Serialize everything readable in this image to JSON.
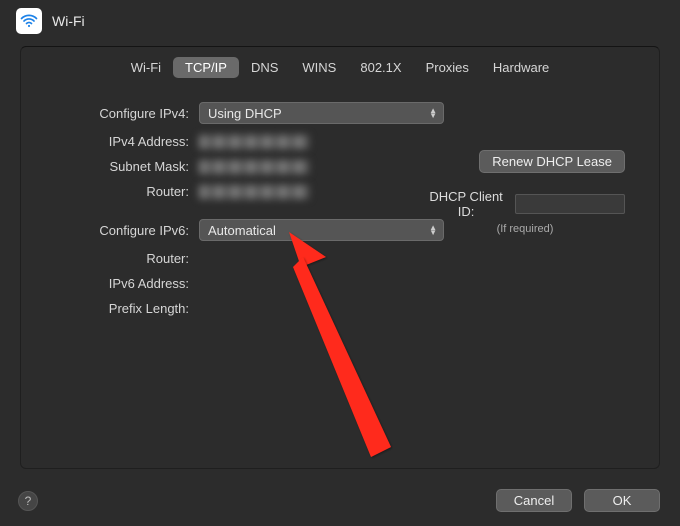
{
  "header": {
    "title": "Wi-Fi"
  },
  "tabs": {
    "items": [
      "Wi-Fi",
      "TCP/IP",
      "DNS",
      "WINS",
      "802.1X",
      "Proxies",
      "Hardware"
    ],
    "active": "TCP/IP"
  },
  "form": {
    "configure_ipv4_label": "Configure IPv4:",
    "configure_ipv4_value": "Using DHCP",
    "ipv4_address_label": "IPv4 Address:",
    "subnet_mask_label": "Subnet Mask:",
    "router_label": "Router:",
    "configure_ipv6_label": "Configure IPv6:",
    "configure_ipv6_value": "Automatical",
    "router6_label": "Router:",
    "ipv6_address_label": "IPv6 Address:",
    "prefix_length_label": "Prefix Length:"
  },
  "right": {
    "renew_button": "Renew DHCP Lease",
    "dhcp_client_id_label": "DHCP Client ID:",
    "hint": "(If required)"
  },
  "footer": {
    "help": "?",
    "cancel": "Cancel",
    "ok": "OK"
  }
}
